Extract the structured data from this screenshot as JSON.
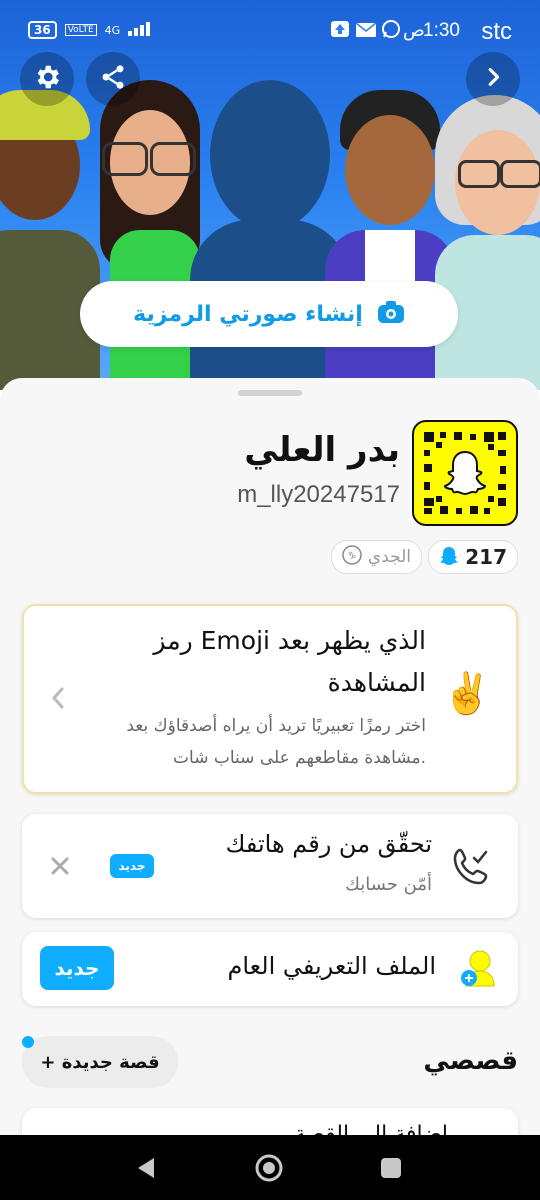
{
  "status_bar": {
    "carrier": "stc",
    "time": "1:30",
    "period": "ص",
    "battery": "36",
    "network_volte": "VoLTE",
    "network_type": "4G"
  },
  "hero": {
    "create_avatar_label": "إنشاء صورتي الرمزية"
  },
  "profile": {
    "display_name": "بدر العلي",
    "username": "m_lly20247517",
    "snapscore": "217",
    "zodiac_label": "الجدي"
  },
  "emoji_card": {
    "title": "رمز Emoji الذي يظهر بعد المشاهدة",
    "description": "اختر رمزًا تعبيريًا تريد أن يراه أصدقاؤك بعد مشاهدة مقاطعهم على سناب شات.",
    "emoji": "✌️"
  },
  "phone_card": {
    "title": "تحقّق من رقم هاتفك",
    "subtitle": "أمّن حسابك",
    "badge": "جديد"
  },
  "public_profile_card": {
    "title": "الملف التعريفي العام",
    "badge": "جديد"
  },
  "stories": {
    "heading": "قصصي",
    "new_story_label": "+ قصة جديدة",
    "add_to_story_partial": "إضافة إلى القصة"
  },
  "colors": {
    "accent": "#0fadff",
    "snap_yellow": "#fffc00",
    "hero_blue": "#2a80f0"
  }
}
